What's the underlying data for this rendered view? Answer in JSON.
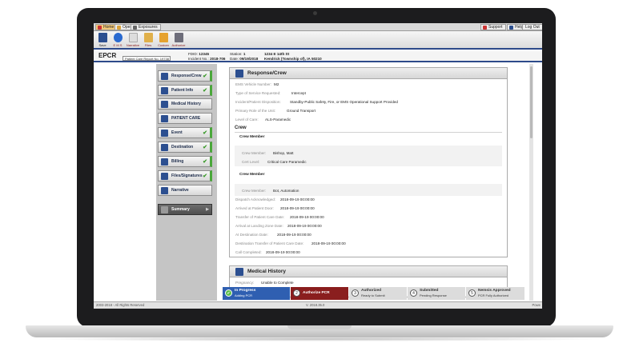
{
  "top_buttons": {
    "home": "Home",
    "open": "Open",
    "exposures": "Exposures",
    "support": "Support",
    "help": "Help",
    "logout": "Log Out"
  },
  "toolbar": {
    "items": [
      "Save",
      "E M S",
      "Narrative",
      "Files",
      "Custom",
      "Authorize"
    ]
  },
  "header": {
    "app": "EPCR",
    "pcr_select": "Patient Care Report No. 19738",
    "fdid_label": "FDID:",
    "fdid": "12345",
    "incident_label": "Incident No.:",
    "incident": "2018-706",
    "station_label": "Station:",
    "station": "1",
    "date_label": "Date:",
    "date": "09/19/2018",
    "address": "1234 E 14th St",
    "location": "Kendrick (Township of), IA 50210"
  },
  "nav": {
    "items": [
      "Response/Crew",
      "Patient Info",
      "Medical History",
      "PATIENT CARE",
      "Event",
      "Destination",
      "Billing",
      "Files/Signatures",
      "Narrative",
      "Summary"
    ]
  },
  "response_crew": {
    "title": "Response/Crew",
    "rows": [
      {
        "label": "EMS Vehicle Number:",
        "value": "M2"
      },
      {
        "label": "Type of Service Requested:",
        "value": "Intercept"
      },
      {
        "label": "Incident/Patient Disposition:",
        "value": "Standby-Public Safety, Fire, or EMS Operational Support Provided"
      },
      {
        "label": "Primary Role of the Unit:",
        "value": "Ground Transport"
      },
      {
        "label": "Level of Care:",
        "value": "ALS-Paramedic"
      }
    ],
    "crew_heading": "Crew",
    "crew_member_heading": "Crew Member",
    "crew1": [
      {
        "label": "Crew Member:",
        "value": "Bishop, Matt"
      },
      {
        "label": "Cert Level:",
        "value": "Critical Care Paramedic"
      }
    ],
    "crew2": [
      {
        "label": "Crew Member:",
        "value": "Bot, Automation"
      }
    ],
    "times": [
      {
        "label": "Dispatch Acknowledged:",
        "value": "2018-09-19 00:00:00"
      },
      {
        "label": "Arrived at Patient Door:",
        "value": "2018-09-19 00:00:00"
      },
      {
        "label": "Transfer of Patient Care Date:",
        "value": "2018-09-19 00:00:00"
      },
      {
        "label": "Arrival at Landing Zone Date:",
        "value": "2018-09-19 00:00:00"
      },
      {
        "label": "At Destination Date:",
        "value": "2018-09-19 00:00:00"
      },
      {
        "label": "Destination Transfer of Patient Care Date:",
        "value": "2018-09-19 00:00:00"
      },
      {
        "label": "Call Completed:",
        "value": "2018-09-19 00:00:00"
      }
    ]
  },
  "medical_history": {
    "title": "Medical History",
    "pregnancy_label": "Pregnancy:",
    "pregnancy": "Unable to Complete"
  },
  "steps": [
    {
      "n": "1",
      "title": "In Progress",
      "sub": "Adding PCR"
    },
    {
      "n": "2",
      "title": "Authorize PCR",
      "sub": ""
    },
    {
      "n": "3",
      "title": "Authorized",
      "sub": "Ready to Submit"
    },
    {
      "n": "4",
      "title": "Submitted",
      "sub": "Pending Response"
    },
    {
      "n": "5",
      "title": "Nemsis Approved",
      "sub": "PCR Fully Authorized"
    }
  ],
  "footer": {
    "copyright": "2003-2018 - All Rights Reserved",
    "version": "V. 2018.35.0",
    "powered": "Powe"
  },
  "colors": {
    "accent": "#2d4a8a",
    "progress_active": "#2f5fb1",
    "authorize_red": "#8a1e1e",
    "check_green": "#3c9a2c"
  }
}
